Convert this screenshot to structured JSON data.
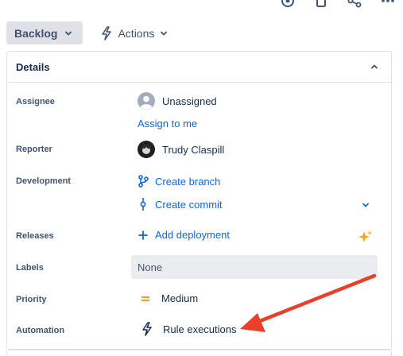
{
  "toolbar": {
    "status_label": "Backlog",
    "actions_label": "Actions"
  },
  "details": {
    "title": "Details",
    "fields": {
      "assignee": {
        "label": "Assignee",
        "value": "Unassigned",
        "action": "Assign to me"
      },
      "reporter": {
        "label": "Reporter",
        "value": "Trudy Claspill"
      },
      "development": {
        "label": "Development",
        "create_branch": "Create branch",
        "create_commit": "Create commit"
      },
      "releases": {
        "label": "Releases",
        "action": "Add deployment"
      },
      "labels": {
        "label": "Labels",
        "value": "None"
      },
      "priority": {
        "label": "Priority",
        "value": "Medium"
      },
      "automation": {
        "label": "Automation",
        "value": "Rule executions"
      }
    }
  },
  "colors": {
    "link": "#0c66e4",
    "priority_medium": "#f59d2a",
    "annotation_arrow": "#e8412a",
    "ai_sparkle": "#f5a623"
  },
  "icons": [
    "watch-icon",
    "copy-icon",
    "share-icon",
    "more-icon",
    "lightning-icon",
    "branch-icon",
    "commit-icon",
    "plus-icon",
    "sparkle-icon",
    "priority-medium-icon",
    "avatar"
  ]
}
